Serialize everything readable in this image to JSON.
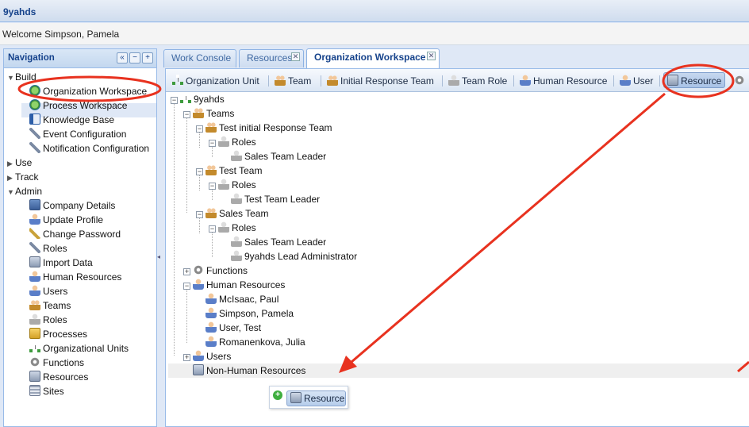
{
  "app": {
    "title": "9yahds",
    "welcome": "Welcome Simpson, Pamela"
  },
  "nav": {
    "header": "Navigation",
    "tools": [
      "«",
      "−",
      "+"
    ],
    "sections": [
      {
        "label": "Build",
        "expanded": true,
        "items": [
          {
            "label": "Organization Workspace",
            "icon": "globe-icon",
            "selected": true
          },
          {
            "label": "Process Workspace",
            "icon": "globe-icon"
          },
          {
            "label": "Knowledge Base",
            "icon": "book-icon"
          },
          {
            "label": "Event Configuration",
            "icon": "wrench-icon"
          },
          {
            "label": "Notification Configuration",
            "icon": "wrench-icon"
          }
        ]
      },
      {
        "label": "Use",
        "expanded": false,
        "items": []
      },
      {
        "label": "Track",
        "expanded": false,
        "items": []
      },
      {
        "label": "Admin",
        "expanded": true,
        "items": [
          {
            "label": "Company Details",
            "icon": "computer-icon"
          },
          {
            "label": "Update Profile",
            "icon": "person-icon"
          },
          {
            "label": "Change Password",
            "icon": "key-icon"
          },
          {
            "label": "Roles",
            "icon": "wrench-icon"
          },
          {
            "label": "Import Data",
            "icon": "screen-icon"
          },
          {
            "label": "Human Resources",
            "icon": "person-icon"
          },
          {
            "label": "Users",
            "icon": "person-icon"
          },
          {
            "label": "Teams",
            "icon": "team-icon"
          },
          {
            "label": "Roles",
            "icon": "grey-person-icon"
          },
          {
            "label": "Processes",
            "icon": "box-icon"
          },
          {
            "label": "Organizational Units",
            "icon": "org-icon"
          },
          {
            "label": "Functions",
            "icon": "gear-icon"
          },
          {
            "label": "Resources",
            "icon": "screen-icon"
          },
          {
            "label": "Sites",
            "icon": "building-icon"
          }
        ]
      }
    ]
  },
  "tabs": [
    {
      "label": "Work Console",
      "closable": false
    },
    {
      "label": "Resources",
      "closable": true
    },
    {
      "label": "Organization Workspace",
      "closable": true,
      "active": true
    }
  ],
  "toolbar": [
    {
      "label": "Organization Unit",
      "icon": "org-icon"
    },
    {
      "label": "Team",
      "icon": "team-icon"
    },
    {
      "label": "Initial Response Team",
      "icon": "team-icon"
    },
    {
      "label": "Team Role",
      "icon": "grey-person-icon"
    },
    {
      "label": "Human Resource",
      "icon": "person-icon"
    },
    {
      "label": "User",
      "icon": "person-icon"
    },
    {
      "label": "Resource",
      "icon": "screen-icon",
      "pressed": true
    }
  ],
  "tree": {
    "root": "9yahds",
    "teams": "Teams",
    "team1": "Test initial Response Team",
    "team2": "Test Team",
    "team3": "Sales Team",
    "roles": "Roles",
    "role_sales_leader": "Sales Team Leader",
    "role_test_leader": "Test Team Leader",
    "role_lead_admin": "9yahds Lead Administrator",
    "functions": "Functions",
    "human_resources": "Human Resources",
    "hr": [
      "McIsaac, Paul",
      "Simpson, Pamela",
      "User, Test",
      "Romanenkova, Julia"
    ],
    "users": "Users",
    "non_human": "Non-Human Resources"
  },
  "drag": {
    "label": "Resource",
    "plus": "+"
  },
  "colors": {
    "annotation": "#e8321f",
    "accent": "#15428b"
  }
}
